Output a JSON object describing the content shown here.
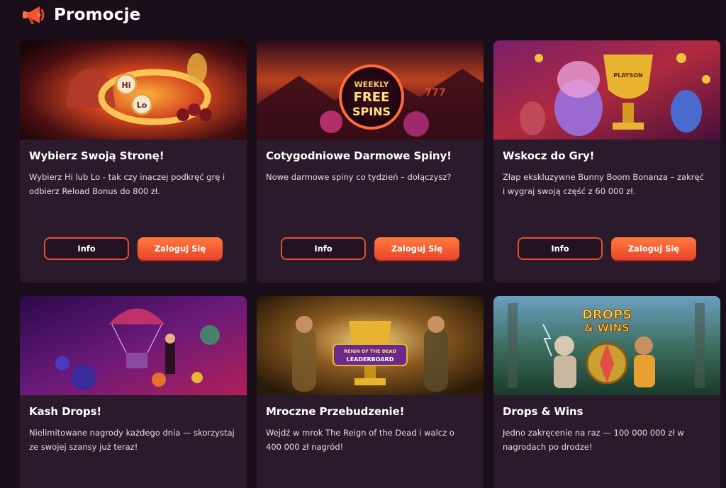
{
  "header": {
    "title": "Promocje",
    "icon": "megaphone-icon"
  },
  "colors": {
    "background": "#1b0e1b",
    "card": "#2a1a2c",
    "accent": "#f0552f",
    "button_gradient_top": "#ff7a3f",
    "button_gradient_bottom": "#e8452a"
  },
  "cards": [
    {
      "title": "Wybierz Swoją Stronę!",
      "description": "Wybierz Hi lub Lo - tak czy inaczej podkręć grę i odbierz Reload Bonus do 800 zł.",
      "banner_text": [
        "Hi",
        "Lo"
      ],
      "info_label": "Info",
      "login_label": "Zaloguj Się"
    },
    {
      "title": "Cotygodniowe Darmowe Spiny!",
      "description": "Nowe darmowe spiny co tydzień – dołączysz?",
      "banner_text": [
        "WEEKLY",
        "FREE",
        "SPINS",
        "777"
      ],
      "info_label": "Info",
      "login_label": "Zaloguj Się"
    },
    {
      "title": "Wskocz do Gry!",
      "description": "Złap ekskluzywne Bunny Boom Bonanza – zakręć i wygraj swoją część z 60 000 zł.",
      "banner_text": [
        "PLAYSON"
      ],
      "info_label": "Info",
      "login_label": "Zaloguj Się"
    },
    {
      "title": "Kash Drops!",
      "description": "Nielimitowane nagrody każdego dnia — skorzystaj ze swojej szansy już teraz!",
      "banner_text": [],
      "info_label": "",
      "login_label": ""
    },
    {
      "title": "Mroczne Przebudzenie!",
      "description": "Wejdź w mrok The Reign of the Dead i walcz o 400 000 zł nagród!",
      "banner_text": [
        "REIGN OF THE DEAD",
        "LEADERBOARD"
      ],
      "info_label": "",
      "login_label": ""
    },
    {
      "title": "Drops & Wins",
      "description": "Jedno zakręcenie na raz — 100 000 000 zł w nagrodach po drodze!",
      "banner_text": [
        "DROPS",
        "& WINS"
      ],
      "info_label": "",
      "login_label": ""
    }
  ]
}
